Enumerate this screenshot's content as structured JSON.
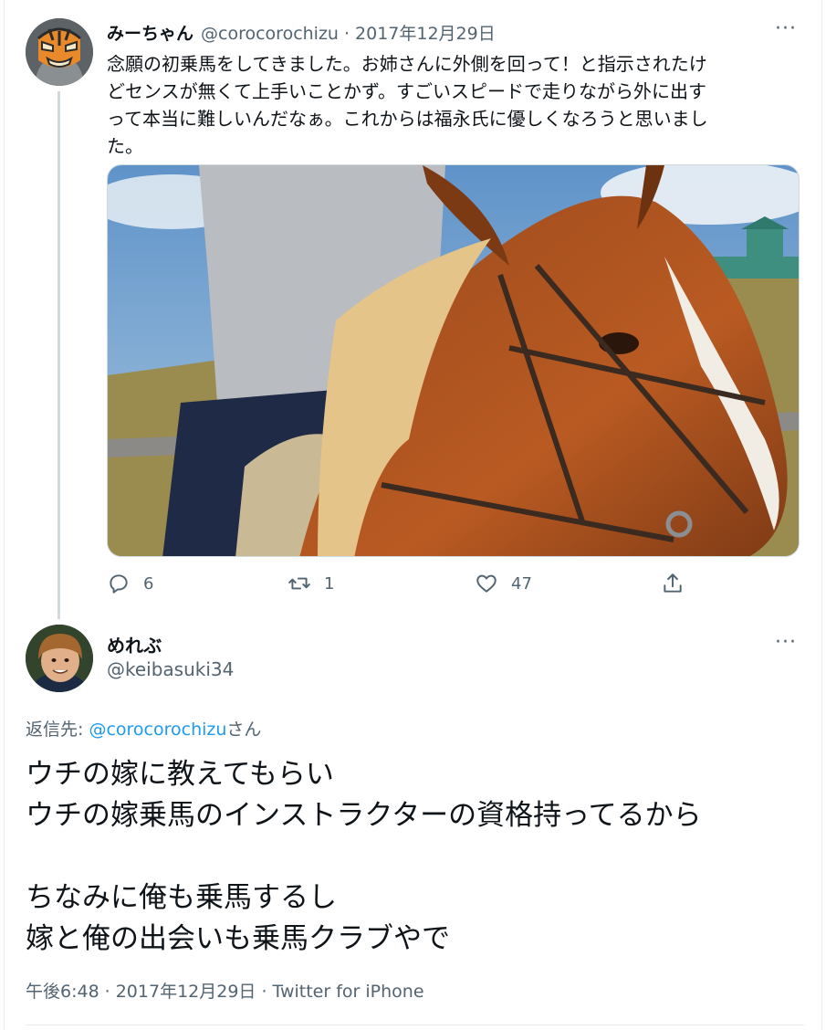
{
  "tweet": {
    "author_name": "みーちゃん",
    "author_handle": "@corocorochizu",
    "date": "2017年12月29日",
    "more_label": "···",
    "text_lines": [
      "念願の初乗馬をしてきました。お姉さんに外側を回って！と指示されたけ",
      "どセンスが無くて上手いことかず。すごいスピードで走りながら外に出す",
      "って本当に難しいんだなぁ。これからは福永氏に優しくなろうと思いまし",
      "た。"
    ],
    "stats": {
      "replies": "6",
      "retweets": "1",
      "likes": "47"
    }
  },
  "reply": {
    "author_name": "めれぶ",
    "author_handle": "@keibasuki34",
    "more_label": "···",
    "reply_prefix": "返信先: ",
    "reply_mention": "@corocorochizu",
    "reply_suffix": "さん",
    "text_lines": [
      "ウチの嫁に教えてもらい",
      "ウチの嫁乗馬のインストラクターの資格持ってるから",
      "",
      "ちなみに俺も乗馬するし",
      "嫁と俺の出会いも乗馬クラブやで"
    ],
    "time": "午後6:48",
    "date": "2017年12月29日",
    "source": "Twitter for iPhone",
    "separator": "·"
  },
  "icons": {
    "reply": "reply-icon",
    "retweet": "retweet-icon",
    "like": "heart-icon",
    "share": "share-icon",
    "more": "more-icon"
  },
  "colors": {
    "text": "#0f1419",
    "secondary": "#536471",
    "link": "#1d9bf0",
    "border": "#cfd9de"
  }
}
